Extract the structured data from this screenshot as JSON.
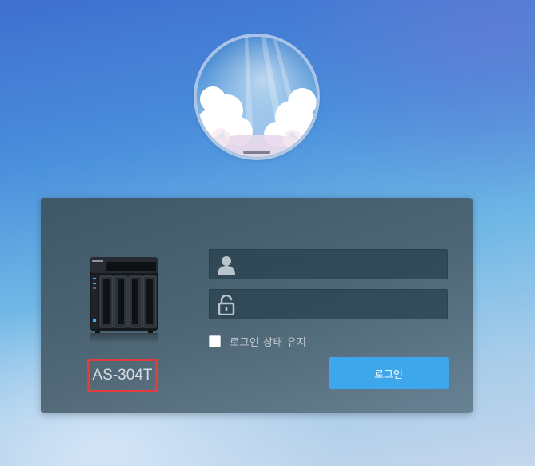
{
  "login": {
    "model_name": "AS-304T",
    "username": {
      "value": "",
      "placeholder": ""
    },
    "password": {
      "value": "",
      "placeholder": ""
    },
    "remember_label": "로그인 상태 유지",
    "remember_checked": false,
    "login_button_label": "로그인"
  },
  "icons": {
    "avatar": "sky-clouds-avatar",
    "device": "nas-device-image",
    "username_field": "user-icon",
    "password_field": "lock-icon"
  },
  "colors": {
    "login_button": "#3ea6ea",
    "highlight_border": "#e23c3c"
  }
}
